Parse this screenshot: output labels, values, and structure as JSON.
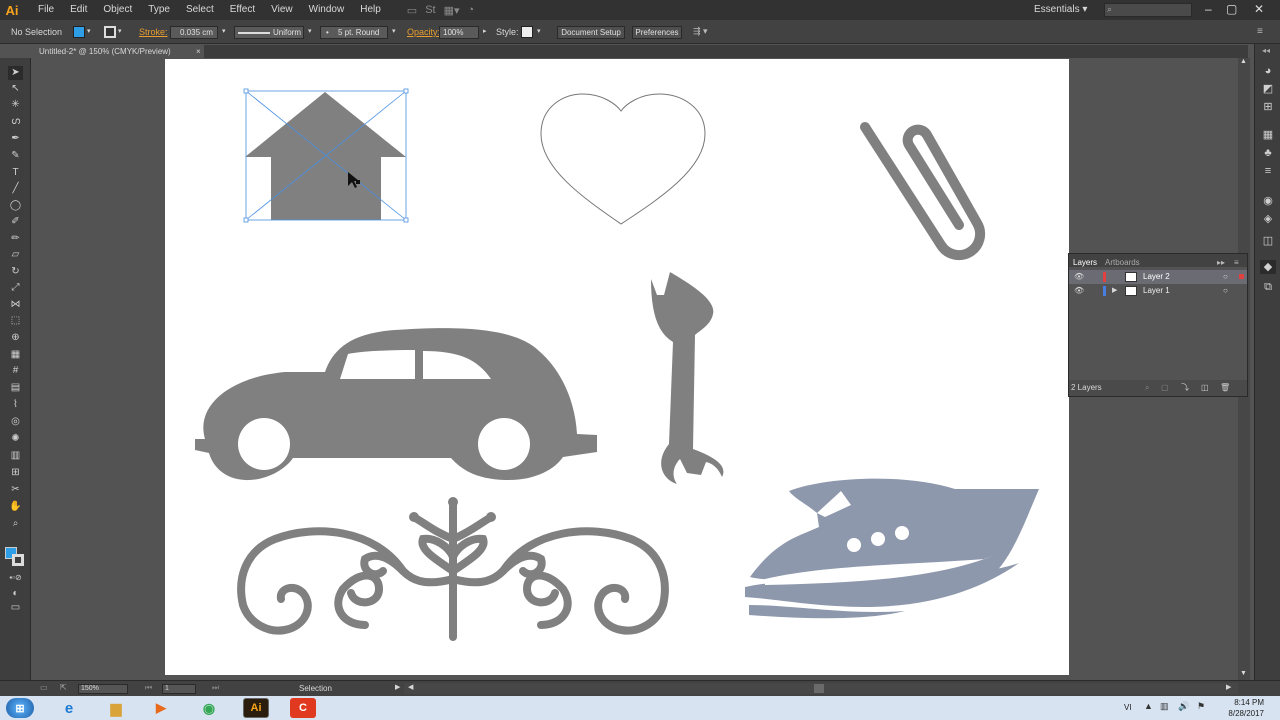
{
  "app": {
    "logo": "Ai",
    "workspace": "Essentials",
    "search_placeholder": ""
  },
  "menu": [
    "File",
    "Edit",
    "Object",
    "Type",
    "Select",
    "Effect",
    "View",
    "Window",
    "Help"
  ],
  "control_bar": {
    "selection_status": "No Selection",
    "stroke_label": "Stroke:",
    "stroke_value": "0.035 cm",
    "stroke_profile": "Uniform",
    "brush": "5 pt. Round",
    "opacity_label": "Opacity:",
    "opacity_value": "100%",
    "style_label": "Style:",
    "document_setup": "Document Setup",
    "preferences": "Preferences",
    "fill_color": "#2e9fe6"
  },
  "document_tab": {
    "title": "Untitled-2* @ 150% (CMYK/Preview)",
    "close": "×"
  },
  "layers_panel": {
    "tabs": [
      "Layers",
      "Artboards"
    ],
    "layers": [
      {
        "name": "Layer 2",
        "color": "#e04040",
        "selected": true
      },
      {
        "name": "Layer 1",
        "color": "#4a7de0",
        "selected": false
      }
    ],
    "count": "2 Layers"
  },
  "status_bar": {
    "zoom": "150%",
    "artboard": "1",
    "tool": "Selection"
  },
  "taskbar": {
    "language": "VI",
    "time": "8:14 PM",
    "date": "8/28/2017"
  },
  "artwork": {
    "shape_color": "#808080",
    "boat_color": "#8e98ac",
    "selection_color": "#4a90e2"
  }
}
